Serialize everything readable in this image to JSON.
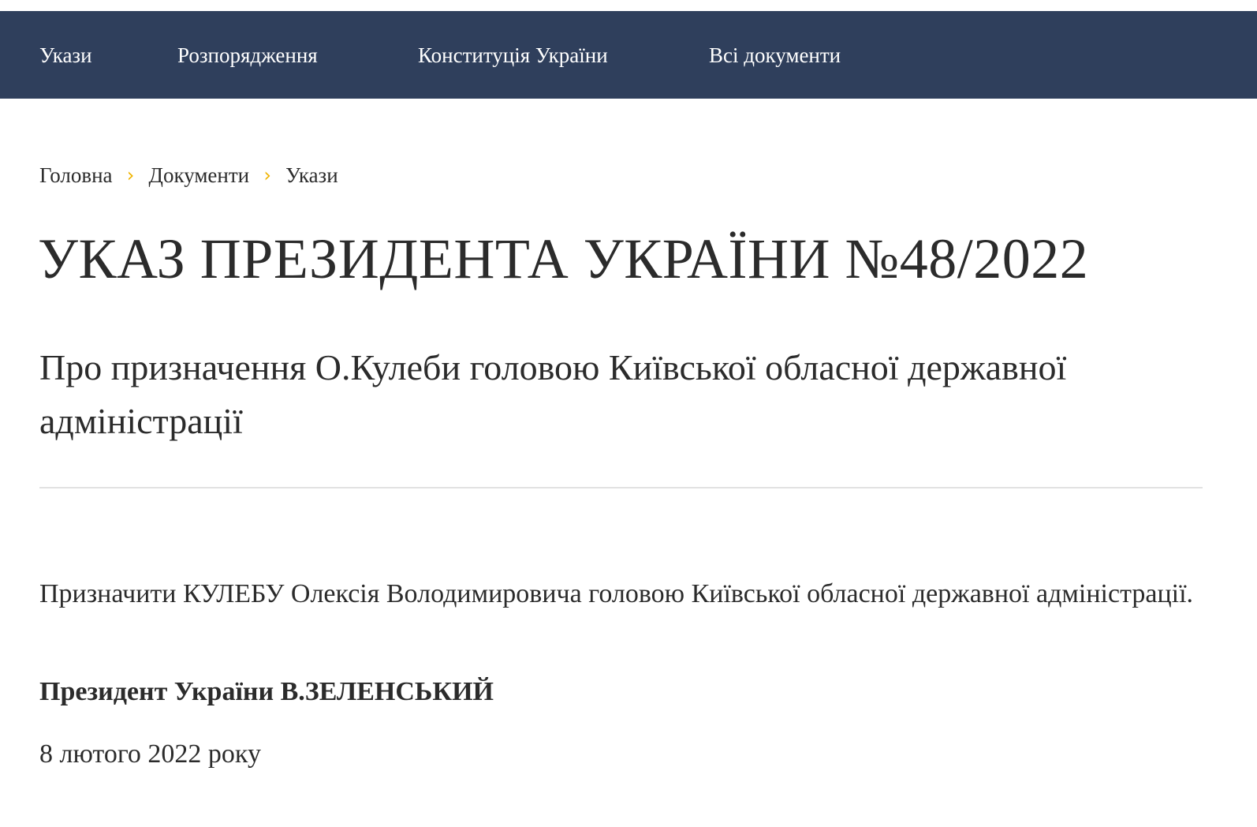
{
  "nav": {
    "items": [
      {
        "label": "Укази"
      },
      {
        "label": "Розпорядження"
      },
      {
        "label": "Конституція України"
      },
      {
        "label": "Всі документи"
      }
    ]
  },
  "breadcrumb": {
    "items": [
      {
        "label": "Головна"
      },
      {
        "label": "Документи"
      },
      {
        "label": "Укази"
      }
    ],
    "separator": "›",
    "separator_color": "#f0b400"
  },
  "document": {
    "title": "УКАЗ ПРЕЗИДЕНТА УКРАЇНИ №48/2022",
    "subtitle": "Про призначення О.Кулеби головою Київської обласної державної адміністрації",
    "body": "Призначити КУЛЕБУ Олексія Володимировича головою Київської обласної державної адміністрації.",
    "signature": "Президент України В.ЗЕЛЕНСЬКИЙ",
    "date": "8 лютого 2022 року"
  },
  "colors": {
    "navbar": "#2f3f5c",
    "text": "#2b2b2b",
    "accent": "#f0b400"
  }
}
